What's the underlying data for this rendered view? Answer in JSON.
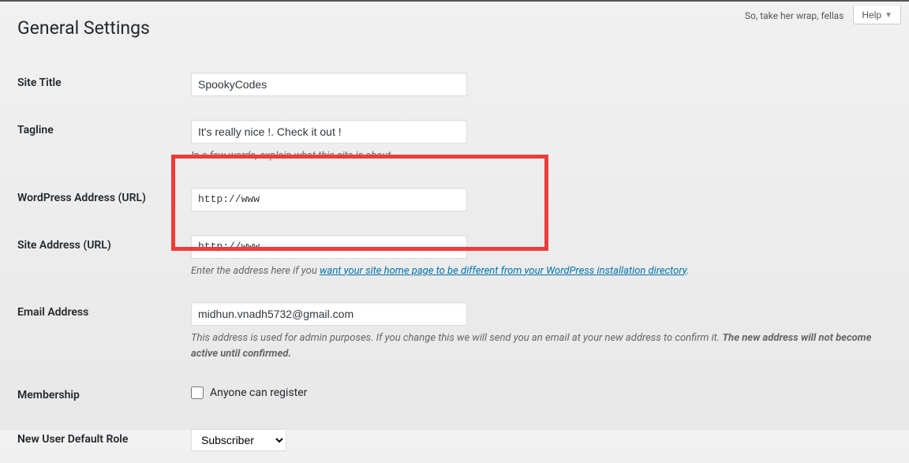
{
  "header": {
    "toast": "So, take her wrap, fellas",
    "help_label": "Help"
  },
  "page": {
    "title": "General Settings"
  },
  "fields": {
    "site_title": {
      "label": "Site Title",
      "value": "SpookyCodes"
    },
    "tagline": {
      "label": "Tagline",
      "value": "It's really nice !. Check it out !",
      "description": "In a few words, explain what this site is about."
    },
    "wp_url": {
      "label": "WordPress Address (URL)",
      "value": "http://www"
    },
    "site_url": {
      "label": "Site Address (URL)",
      "value": "http://www",
      "desc_prefix": "Enter the address here if you ",
      "desc_link": "want your site home page to be different from your WordPress installation directory",
      "desc_suffix": "."
    },
    "email": {
      "label": "Email Address",
      "value": "midhun.vnadh5732@gmail.com",
      "desc_prefix": "This address is used for admin purposes. If you change this we will send you an email at your new address to confirm it. ",
      "desc_bold": "The new address will not become active until confirmed."
    },
    "membership": {
      "label": "Membership",
      "checkbox_label": "Anyone can register"
    },
    "default_role": {
      "label": "New User Default Role",
      "selected": "Subscriber"
    }
  }
}
